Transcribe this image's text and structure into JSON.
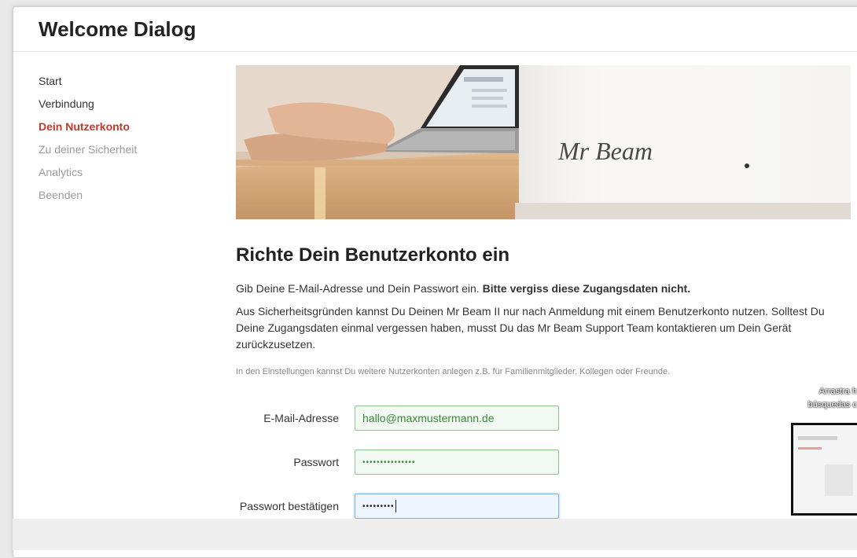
{
  "dialog": {
    "title": "Welcome Dialog"
  },
  "sidebar": {
    "items": [
      {
        "label": "Start",
        "state": "done"
      },
      {
        "label": "Verbindung",
        "state": "done"
      },
      {
        "label": "Dein Nutzerkonto",
        "state": "active"
      },
      {
        "label": "Zu deiner Sicherheit",
        "state": "disabled"
      },
      {
        "label": "Analytics",
        "state": "disabled"
      },
      {
        "label": "Beenden",
        "state": "disabled"
      }
    ]
  },
  "hero": {
    "logo_text": "Mr Beam"
  },
  "main": {
    "heading": "Richte Dein Benutzerkonto ein",
    "intro_text": "Gib Deine E-Mail-Adresse und Dein Passwort ein. ",
    "intro_bold": "Bitte vergiss diese Zugangsdaten nicht.",
    "paragraph": "Aus Sicherheitsgründen kannst Du Deinen Mr Beam II nur nach Anmeldung mit einem Benutzerkonto nutzen. Solltest Du Deine Zugangsdaten einmal vergessen haben, musst Du das Mr Beam Support Team kontaktieren um Dein Gerät zurückzusetzen.",
    "note": "In den Einstellungen kannst Du weitere Nutzerkonten anlegen z.B. für Familienmitglieder, Kollegen oder Freunde."
  },
  "form": {
    "email_label": "E-Mail-Adresse",
    "email_value": "hallo@maxmustermann.de",
    "password_label": "Passwort",
    "password_value": "•••••••••••••••",
    "confirm_label": "Passwort bestätigen",
    "confirm_value": "•••••••••"
  },
  "overlay": {
    "line1": "Arrastra h",
    "line2": "búsquedas c"
  },
  "colors": {
    "accent": "#c0392b",
    "valid_border": "#8fc491",
    "focus_border": "#7fb0e8"
  }
}
